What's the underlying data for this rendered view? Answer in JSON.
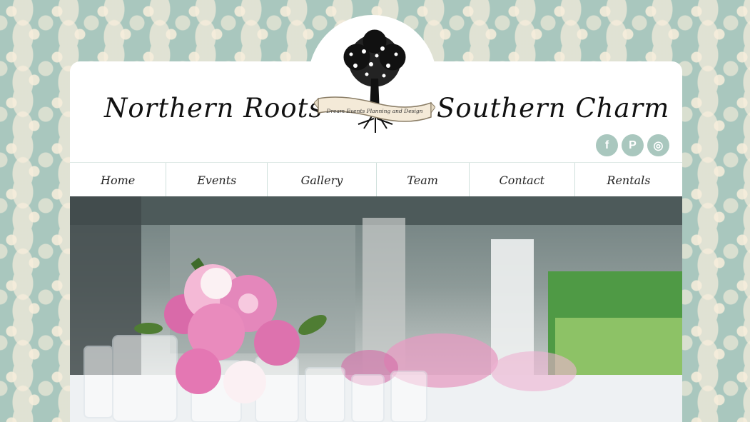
{
  "brand": {
    "left": "Northern Roots",
    "right": "Southern Charm",
    "banner": "Dream Events Planning and Design"
  },
  "social": [
    {
      "icon": "facebook-icon",
      "glyph": "f"
    },
    {
      "icon": "pinterest-icon",
      "glyph": "P"
    },
    {
      "icon": "instagram-icon",
      "glyph": "◎"
    }
  ],
  "nav": {
    "items": [
      "Home",
      "Events",
      "Gallery",
      "Team",
      "Contact",
      "Rentals"
    ]
  },
  "colors": {
    "accent": "#a9c7be",
    "background_pattern": "#a9c7be",
    "pattern_cream": "#f8eedc",
    "peony_pink": "#e07fb0"
  },
  "hero": {
    "image": "table-centerpiece-peonies"
  }
}
